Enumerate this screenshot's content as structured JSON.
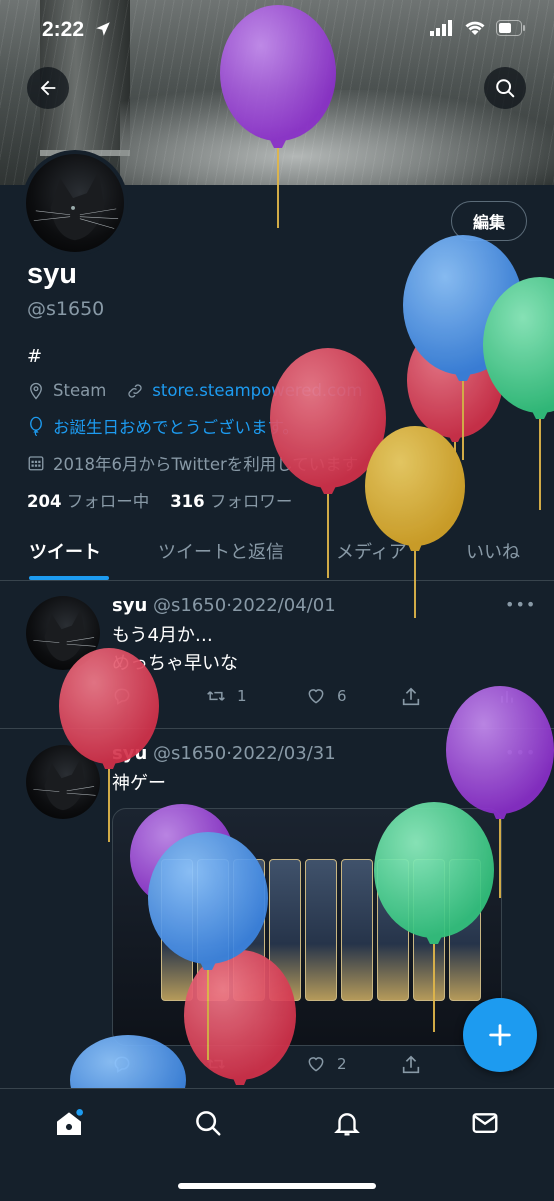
{
  "status_bar": {
    "time": "2:22"
  },
  "profile": {
    "edit_label": "編集",
    "display_name": "syu",
    "handle": "@s1650",
    "bio": "#",
    "location": "Steam",
    "website": "store.steampowered.com",
    "birthday_text": "お誕生日おめでとうございます。",
    "joined": "2018年6月からTwitterを利用しています",
    "following_count": "204",
    "following_label": "フォロー中",
    "followers_count": "316",
    "followers_label": "フォロワー"
  },
  "tabs": [
    {
      "label": "ツイート",
      "active": true
    },
    {
      "label": "ツイートと返信"
    },
    {
      "label": "メディア"
    },
    {
      "label": "いいね"
    }
  ],
  "tweets": [
    {
      "name": "syu",
      "handle": "@s1650",
      "date": "2022/04/01",
      "lines": [
        "もう4月か…",
        "めっちゃ早いな"
      ],
      "retweets": "1",
      "likes": "6"
    },
    {
      "name": "syu",
      "handle": "@s1650",
      "date": "2022/03/31",
      "lines": [
        "神ゲー"
      ],
      "retweets": "",
      "likes": "2"
    }
  ],
  "icons": [
    "back-arrow-icon",
    "search-icon",
    "location-icon",
    "link-icon",
    "balloon-icon",
    "calendar-icon",
    "reply-icon",
    "retweet-icon",
    "like-icon",
    "share-icon",
    "analytics-icon",
    "compose-plus-icon",
    "home-icon",
    "explore-icon",
    "notifications-icon",
    "messages-icon"
  ],
  "colors": {
    "background": "#15202b",
    "accent": "#1d9bf0",
    "secondary_text": "#8899a6",
    "divider": "#38444d"
  }
}
